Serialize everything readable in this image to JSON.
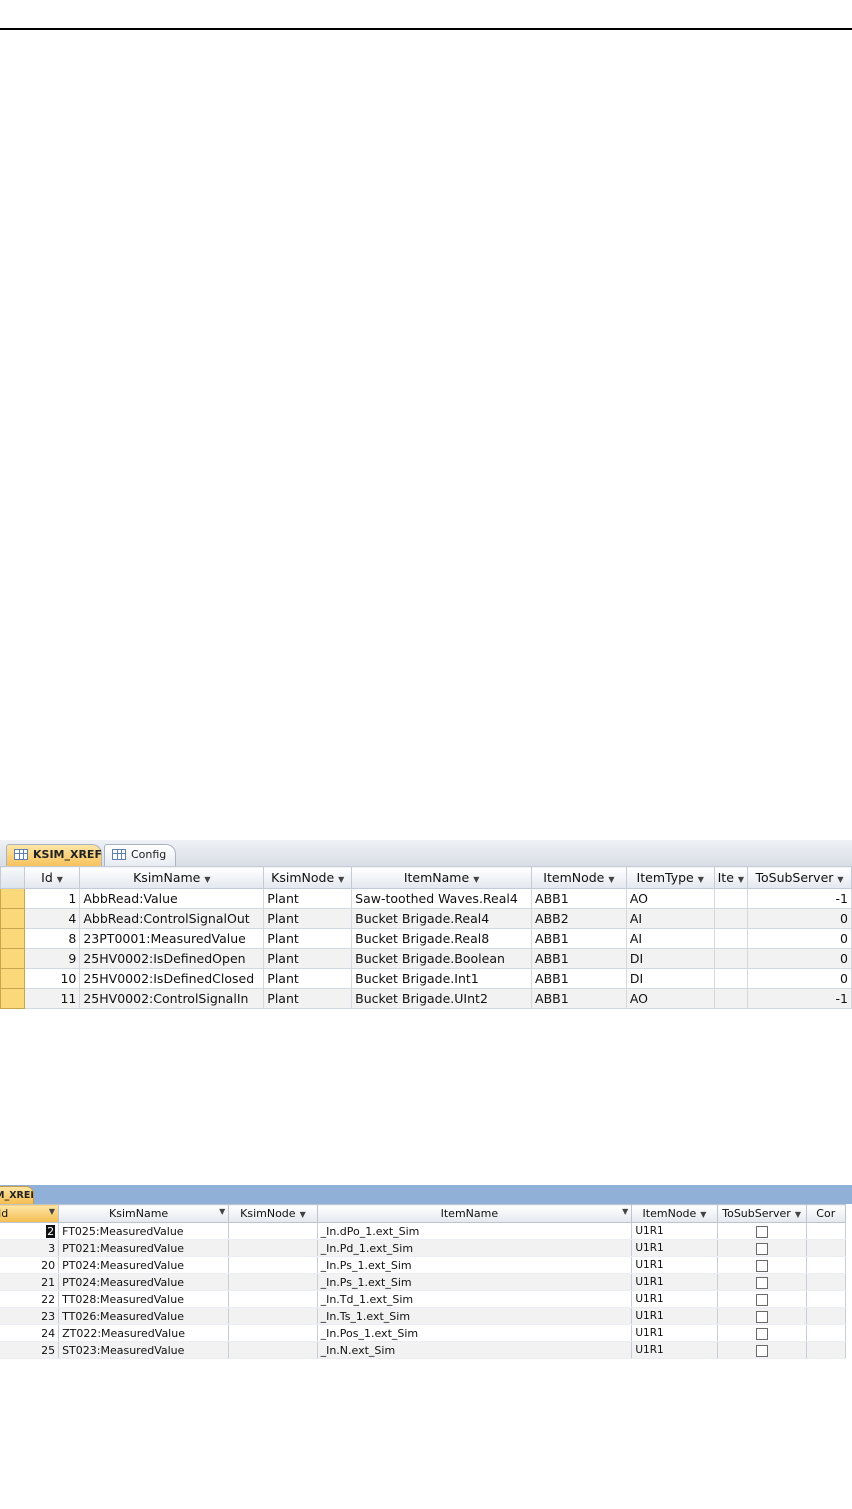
{
  "table1": {
    "tabs": [
      {
        "label": "KSIM_XREF",
        "icon": "table-icon"
      },
      {
        "label": "Config",
        "icon": "table-icon"
      }
    ],
    "columns": [
      "Id",
      "KsimName",
      "KsimNode",
      "ItemName",
      "ItemNode",
      "ItemType",
      "Ite",
      "ToSubServer"
    ],
    "rows": [
      {
        "Id": "1",
        "KsimName": "AbbRead:Value",
        "KsimNode": "Plant",
        "ItemName": "Saw-toothed Waves.Real4",
        "ItemNode": "ABB1",
        "ItemType": "AO",
        "Ite": "",
        "ToSubServer": "-1"
      },
      {
        "Id": "4",
        "KsimName": "AbbRead:ControlSignalOut",
        "KsimNode": "Plant",
        "ItemName": "Bucket Brigade.Real4",
        "ItemNode": "ABB2",
        "ItemType": "AI",
        "Ite": "",
        "ToSubServer": "0"
      },
      {
        "Id": "8",
        "KsimName": "23PT0001:MeasuredValue",
        "KsimNode": "Plant",
        "ItemName": "Bucket Brigade.Real8",
        "ItemNode": "ABB1",
        "ItemType": "AI",
        "Ite": "",
        "ToSubServer": "0"
      },
      {
        "Id": "9",
        "KsimName": "25HV0002:IsDefinedOpen",
        "KsimNode": "Plant",
        "ItemName": "Bucket Brigade.Boolean",
        "ItemNode": "ABB1",
        "ItemType": "DI",
        "Ite": "",
        "ToSubServer": "0"
      },
      {
        "Id": "10",
        "KsimName": "25HV0002:IsDefinedClosed",
        "KsimNode": "Plant",
        "ItemName": "Bucket Brigade.Int1",
        "ItemNode": "ABB1",
        "ItemType": "DI",
        "Ite": "",
        "ToSubServer": "0"
      },
      {
        "Id": "11",
        "KsimName": "25HV0002:ControlSignalIn",
        "KsimNode": "Plant",
        "ItemName": "Bucket Brigade.UInt2",
        "ItemNode": "ABB1",
        "ItemType": "AO",
        "Ite": "",
        "ToSubServer": "-1"
      }
    ]
  },
  "table2": {
    "tab_label": "M_XREF",
    "columns": [
      "Id",
      "KsimName",
      "KsimNode",
      "ItemName",
      "ItemNode",
      "ToSubServer",
      "Cor"
    ],
    "rows": [
      {
        "Id": "2",
        "KsimName": "FT025:MeasuredValue",
        "KsimNode": "",
        "ItemName": "_In.dPo_1.ext_Sim",
        "ItemNode": "U1R1",
        "ToSubServer": false
      },
      {
        "Id": "3",
        "KsimName": "PT021:MeasuredValue",
        "KsimNode": "",
        "ItemName": "_In.Pd_1.ext_Sim",
        "ItemNode": "U1R1",
        "ToSubServer": false
      },
      {
        "Id": "20",
        "KsimName": "PT024:MeasuredValue",
        "KsimNode": "",
        "ItemName": "_In.Ps_1.ext_Sim",
        "ItemNode": "U1R1",
        "ToSubServer": false
      },
      {
        "Id": "21",
        "KsimName": "PT024:MeasuredValue",
        "KsimNode": "",
        "ItemName": "_In.Ps_1.ext_Sim",
        "ItemNode": "U1R1",
        "ToSubServer": false
      },
      {
        "Id": "22",
        "KsimName": "TT028:MeasuredValue",
        "KsimNode": "",
        "ItemName": "_In.Td_1.ext_Sim",
        "ItemNode": "U1R1",
        "ToSubServer": false
      },
      {
        "Id": "23",
        "KsimName": "TT026:MeasuredValue",
        "KsimNode": "",
        "ItemName": "_In.Ts_1.ext_Sim",
        "ItemNode": "U1R1",
        "ToSubServer": false
      },
      {
        "Id": "24",
        "KsimName": "ZT022:MeasuredValue",
        "KsimNode": "",
        "ItemName": "_In.Pos_1.ext_Sim",
        "ItemNode": "U1R1",
        "ToSubServer": false
      },
      {
        "Id": "25",
        "KsimName": "ST023:MeasuredValue",
        "KsimNode": "",
        "ItemName": "_In.N.ext_Sim",
        "ItemNode": "U1R1",
        "ToSubServer": false
      }
    ]
  },
  "colors": {
    "tab_active": "#f7c25b",
    "row_selector": "#fbd97a",
    "tabbar_blue": "#90b0d8"
  }
}
